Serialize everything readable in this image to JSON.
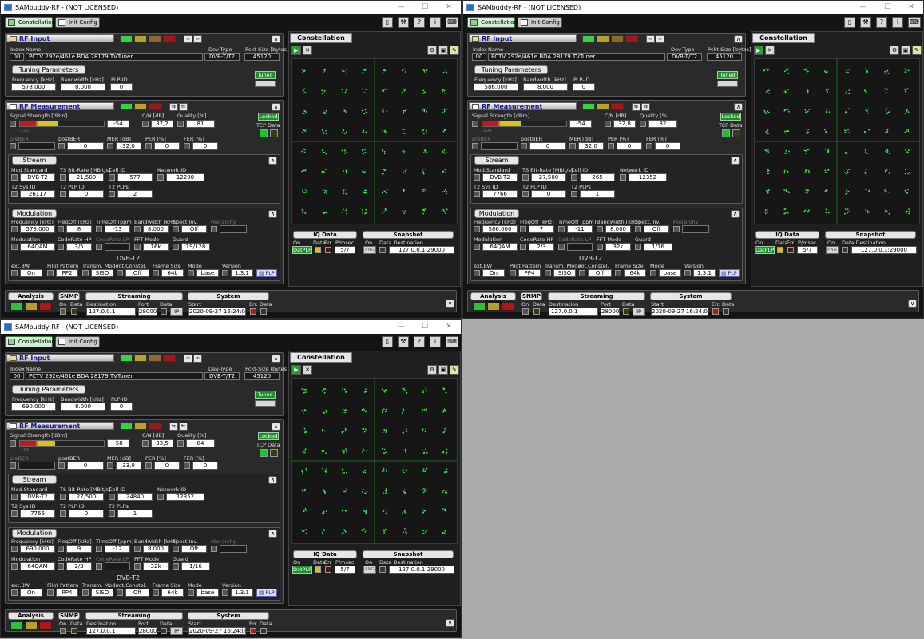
{
  "windows": [
    {
      "title": "SAMbuddy-RF - (NOT LICENSED)",
      "tabs": [
        "Constellation",
        "Init Config"
      ],
      "rf_input": {
        "header": "RF Input",
        "index_label": "Index",
        "index": "00",
        "name_label": "Name",
        "name": "PCTV 292e/461e BDA 28179 TVTuner",
        "devtype_label": "Dev-Type",
        "devtype": "DVB-T/T2",
        "pckt_label": "Pckt-Size [bytes]",
        "pckt": "45120",
        "tuning_header": "Tuning Parameters",
        "freq_label": "Frequency [kHz]",
        "freq": "578.000",
        "bw_label": "Bandwidth [kHz]",
        "bw": "8.000",
        "plp_label": "PLP-ID",
        "plp": "0",
        "tuned": "Tuned"
      },
      "rf_meas": {
        "header": "RF Measurement",
        "signal_label": "Signal Strength [dBm]",
        "signal": "-54",
        "scale_min": "-100",
        "cn_label": "C/N [dB]",
        "cn": "32,2",
        "quality_label": "Quality [%]",
        "quality": "81",
        "locked": "Locked",
        "tcp_label": "TCP Data",
        "prebar_label": "preBER",
        "postber_label": "postBER",
        "postber": "0",
        "mer_label": "MER [dB]",
        "mer": "32,0",
        "per_label": "PER [%]",
        "per": "0",
        "fer_label": "FER [%]",
        "fer": "0"
      },
      "stream": {
        "header": "Stream",
        "modstd_label": "Mod.Standard",
        "modstd": "DVB-T2",
        "tsrate_label": "TS Bit-Rate [MBit/s]",
        "tsrate": "21,500",
        "cellid_label": "Cell ID",
        "cellid": "577",
        "netid_label": "Network ID",
        "netid": "12290",
        "t2sys_label": "T2 Sys ID",
        "t2sys": "26117",
        "t2plp_label": "T2 PLP ID",
        "t2plp": "0",
        "t2plps_label": "T2 PLPs",
        "t2plps": "2"
      },
      "modulation": {
        "header": "Modulation",
        "freq_label": "Frequency [kHz]",
        "freq": "578.000",
        "freqoff_label": "FreqOff [kHz]",
        "freqoff": "8",
        "timeoff_label": "TimeOff [ppm]",
        "timeoff": "-13",
        "bw_label": "Bandwidth [kHz]",
        "bw": "8.000",
        "specinv_label": "Spect.Inv.",
        "specinv": "Off",
        "hier_label": "Hierarchy",
        "mod_label": "Modulation",
        "mod": "64QAM",
        "crhp_label": "CodeRate HP",
        "crhp": "3/5",
        "crlp_label": "CodeRate LP",
        "fft_label": "FFT Mode",
        "fft": "16k",
        "guard_label": "Guard",
        "guard": "19/128",
        "dvbt2_header": "DVB-T2",
        "extbw_label": "ext.BW",
        "extbw": "On",
        "pilot_label": "Pilot Pattern",
        "pilot": "PP2",
        "trans_label": "Transm. Mode",
        "trans": "SISO",
        "rotc_label": "rot.Constel.",
        "rotc": "Off",
        "fsize_label": "Frame Size",
        "fsize": "64k",
        "mode_label": "Mode",
        "mode": "base",
        "ver_label": "Version",
        "ver": "1.3.1",
        "plp_btn": "PLP"
      },
      "constellation": {
        "header": "Constellation",
        "iq_header": "IQ Data",
        "on_label": "On",
        "data_label": "Data",
        "err_label": "Err",
        "pmsec_label": "P/msec",
        "datplp": "DatPLP",
        "pmsec": "5/7",
        "snap_header": "Snapshot",
        "data_dest_label": "Data Destination",
        "png": "PNG",
        "snap_dest": "127.0.0.1:29000"
      },
      "status": {
        "analysis_header": "Analysis State",
        "snmp_header": "SNMP",
        "on_label": "On",
        "data_label": "Data",
        "streaming_header": "Streaming",
        "dest_label": "Destination",
        "dest": "127.0.0.1",
        "port_label": "Port",
        "port": "28000",
        "sdata_label": "Data",
        "ip": "IP",
        "system_header": "System",
        "start_label": "Start",
        "start": "2020-09-27 16:24:09",
        "err_label": "Err.",
        "sysdata_label": "Data"
      }
    },
    {
      "title": "SAMbuddy-RF - (NOT LICENSED)",
      "tabs": [
        "Constellation",
        "Init Config"
      ],
      "rf_input": {
        "header": "RF Input",
        "index_label": "Index",
        "index": "00",
        "name_label": "Name",
        "name": "PCTV 292e/461e BDA 28179 TVTuner",
        "devtype_label": "Dev-Type",
        "devtype": "DVB-T/T2",
        "pckt_label": "Pckt-Size [bytes]",
        "pckt": "45120",
        "tuning_header": "Tuning Parameters",
        "freq_label": "Frequency [kHz]",
        "freq": "586.000",
        "bw_label": "Bandwidth [kHz]",
        "bw": "8.000",
        "plp_label": "PLP-ID",
        "plp": "0",
        "tuned": "Tuned"
      },
      "rf_meas": {
        "header": "RF Measurement",
        "signal_label": "Signal Strength [dBm]",
        "signal": "-54",
        "scale_min": "-100",
        "cn_label": "C/N [dB]",
        "cn": "32,8",
        "quality_label": "Quality [%]",
        "quality": "82",
        "locked": "Locked",
        "tcp_label": "TCP Data",
        "prebar_label": "preBER",
        "postber_label": "postBER",
        "postber": "0",
        "mer_label": "MER [dB]",
        "mer": "32,0",
        "per_label": "PER [%]",
        "per": "0",
        "fer_label": "FER [%]",
        "fer": "0"
      },
      "stream": {
        "header": "Stream",
        "modstd_label": "Mod.Standard",
        "modstd": "DVB-T2",
        "tsrate_label": "TS Bit-Rate [MBit/s]",
        "tsrate": "27,500",
        "cellid_label": "Cell ID",
        "cellid": "265",
        "netid_label": "Network ID",
        "netid": "12352",
        "t2sys_label": "T2 Sys ID",
        "t2sys": "7766",
        "t2plp_label": "T2 PLP ID",
        "t2plp": "0",
        "t2plps_label": "T2 PLPs",
        "t2plps": "1"
      },
      "modulation": {
        "header": "Modulation",
        "freq_label": "Frequency [kHz]",
        "freq": "586.000",
        "freqoff_label": "FreqOff [kHz]",
        "freqoff": "7",
        "timeoff_label": "TimeOff [ppm]",
        "timeoff": "-11",
        "bw_label": "Bandwidth [kHz]",
        "bw": "8.000",
        "specinv_label": "Spect.Inv.",
        "specinv": "Off",
        "hier_label": "Hierarchy",
        "mod_label": "Modulation",
        "mod": "64QAM",
        "crhp_label": "CodeRate HP",
        "crhp": "2/3",
        "crlp_label": "CodeRate LP",
        "fft_label": "FFT Mode",
        "fft": "32k",
        "guard_label": "Guard",
        "guard": "1/16",
        "dvbt2_header": "DVB-T2",
        "extbw_label": "ext.BW",
        "extbw": "On",
        "pilot_label": "Pilot Pattern",
        "pilot": "PP4",
        "trans_label": "Transm. Mode",
        "trans": "SISO",
        "rotc_label": "rot.Constel.",
        "rotc": "Off",
        "fsize_label": "Frame Size",
        "fsize": "64k",
        "mode_label": "Mode",
        "mode": "base",
        "ver_label": "Version",
        "ver": "1.3.1",
        "plp_btn": "PLP"
      },
      "constellation": {
        "header": "Constellation",
        "iq_header": "IQ Data",
        "on_label": "On",
        "data_label": "Data",
        "err_label": "Err",
        "pmsec_label": "P/msec",
        "datplp": "DatPLP",
        "pmsec": "5/7",
        "snap_header": "Snapshot",
        "data_dest_label": "Data Destination",
        "png": "PNG",
        "snap_dest": "127.0.0.1:29000"
      },
      "status": {
        "analysis_header": "Analysis State",
        "snmp_header": "SNMP",
        "on_label": "On",
        "data_label": "Data",
        "streaming_header": "Streaming",
        "dest_label": "Destination",
        "dest": "127.0.0.1",
        "port_label": "Port",
        "port": "28000",
        "sdata_label": "Data",
        "ip": "IP",
        "system_header": "System",
        "start_label": "Start",
        "start": "2020-09-27 16:24:09",
        "err_label": "Err.",
        "sysdata_label": "Data"
      }
    },
    {
      "title": "SAMbuddy-RF - (NOT LICENSED)",
      "tabs": [
        "Constellation",
        "Init Config"
      ],
      "rf_input": {
        "header": "RF Input",
        "index_label": "Index",
        "index": "00",
        "name_label": "Name",
        "name": "PCTV 292e/461e BDA 28179 TVTuner",
        "devtype_label": "Dev-Type",
        "devtype": "DVB-T/T2",
        "pckt_label": "Pckt-Size [bytes]",
        "pckt": "45120",
        "tuning_header": "Tuning Parameters",
        "freq_label": "Frequency [kHz]",
        "freq": "690.000",
        "bw_label": "Bandwidth [kHz]",
        "bw": "8.000",
        "plp_label": "PLP-ID",
        "plp": "0",
        "tuned": "Tuned"
      },
      "rf_meas": {
        "header": "RF Measurement",
        "signal_label": "Signal Strength [dBm]",
        "signal": "-58",
        "scale_min": "-100",
        "cn_label": "C/N [dB]",
        "cn": "33,5",
        "quality_label": "Quality [%]",
        "quality": "84",
        "locked": "Locked",
        "tcp_label": "TCP Data",
        "prebar_label": "preBER",
        "postber_label": "postBER",
        "postber": "0",
        "mer_label": "MER [dB]",
        "mer": "33,0",
        "per_label": "PER [%]",
        "per": "0",
        "fer_label": "FER [%]",
        "fer": "0"
      },
      "stream": {
        "header": "Stream",
        "modstd_label": "Mod.Standard",
        "modstd": "DVB-T2",
        "tsrate_label": "TS Bit-Rate [MBit/s]",
        "tsrate": "27,500",
        "cellid_label": "Cell ID",
        "cellid": "24840",
        "netid_label": "Network ID",
        "netid": "12352",
        "t2sys_label": "T2 Sys ID",
        "t2sys": "7766",
        "t2plp_label": "T2 PLP ID",
        "t2plp": "0",
        "t2plps_label": "T2 PLPs",
        "t2plps": "1"
      },
      "modulation": {
        "header": "Modulation",
        "freq_label": "Frequency [kHz]",
        "freq": "690.000",
        "freqoff_label": "FreqOff [kHz]",
        "freqoff": "9",
        "timeoff_label": "TimeOff [ppm]",
        "timeoff": "-12",
        "bw_label": "Bandwidth [kHz]",
        "bw": "8.000",
        "specinv_label": "Spect.Inv.",
        "specinv": "Off",
        "hier_label": "Hierarchy",
        "mod_label": "Modulation",
        "mod": "64QAM",
        "crhp_label": "CodeRate HP",
        "crhp": "2/3",
        "crlp_label": "CodeRate LP",
        "fft_label": "FFT Mode",
        "fft": "32k",
        "guard_label": "Guard",
        "guard": "1/16",
        "dvbt2_header": "DVB-T2",
        "extbw_label": "ext.BW",
        "extbw": "On",
        "pilot_label": "Pilot Pattern",
        "pilot": "PP4",
        "trans_label": "Transm. Mode",
        "trans": "SISO",
        "rotc_label": "rot.Constel.",
        "rotc": "Off",
        "fsize_label": "Frame Size",
        "fsize": "64k",
        "mode_label": "Mode",
        "mode": "base",
        "ver_label": "Version",
        "ver": "1.3.1",
        "plp_btn": "PLP"
      },
      "constellation": {
        "header": "Constellation",
        "iq_header": "IQ Data",
        "on_label": "On",
        "data_label": "Data",
        "err_label": "Err",
        "pmsec_label": "P/msec",
        "datplp": "DatPLP",
        "pmsec": "5/7",
        "snap_header": "Snapshot",
        "data_dest_label": "Data Destination",
        "png": "PNG",
        "snap_dest": "127.0.0.1:29000"
      },
      "status": {
        "analysis_header": "Analysis State",
        "snmp_header": "SNMP",
        "on_label": "On",
        "data_label": "Data",
        "streaming_header": "Streaming",
        "dest_label": "Destination",
        "dest": "127.0.0.1",
        "port_label": "Port",
        "port": "28000",
        "sdata_label": "Data",
        "ip": "IP",
        "system_header": "System",
        "start_label": "Start",
        "start": "2020-09-27 16:24:09",
        "err_label": "Err.",
        "sysdata_label": "Data"
      }
    }
  ],
  "theme": {
    "accent_green": "#1fbf32",
    "constellation_point": "#3fe84a",
    "grid": "#1e6e1e"
  }
}
